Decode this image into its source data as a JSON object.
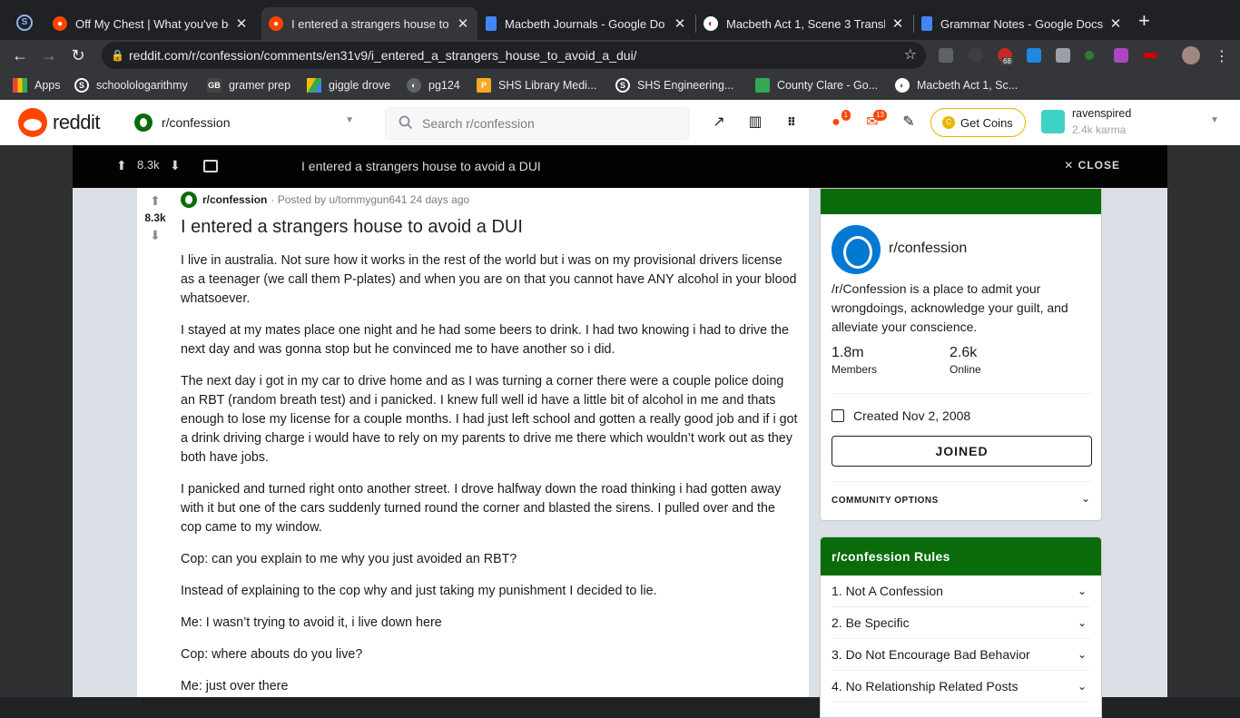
{
  "browser": {
    "tabs": [
      {
        "title": "Off My Chest | What you've be",
        "color": "#ff4500"
      },
      {
        "title": "I entered a strangers house to",
        "color": "#ff4500",
        "active": true
      },
      {
        "title": "Macbeth Journals - Google Do",
        "color": "#4285f4"
      },
      {
        "title": "Macbeth Act 1, Scene 3 Transl",
        "color": "#ffffff"
      },
      {
        "title": "Grammar Notes - Google Docs",
        "color": "#4285f4"
      }
    ],
    "url": "reddit.com/r/confession/comments/en31v9/i_entered_a_strangers_house_to_avoid_a_dui/",
    "ext_badge": "68",
    "bookmarks": [
      {
        "label": "Apps"
      },
      {
        "label": "schoolologarithmy"
      },
      {
        "label": "gramer prep"
      },
      {
        "label": "giggle drove"
      },
      {
        "label": "pg124"
      },
      {
        "label": "SHS Library Medi..."
      },
      {
        "label": "SHS Engineering..."
      },
      {
        "label": "County Clare - Go..."
      },
      {
        "label": "Macbeth Act 1, Sc..."
      }
    ]
  },
  "header": {
    "logo_text": "reddit",
    "community": "r/confession",
    "search_placeholder": "Search r/confession",
    "chat_badge": "1",
    "mail_badge": "13",
    "coins_label": "Get Coins",
    "username": "ravenspired",
    "karma": "2.4k karma"
  },
  "postbar": {
    "score": "8.3k",
    "title": "I entered a strangers house to avoid a DUI",
    "close_label": "CLOSE"
  },
  "post": {
    "score": "8.3k",
    "subreddit": "r/confession",
    "byline": "· Posted by u/tommygun641 24 days ago",
    "title": "I entered a strangers house to avoid a DUI",
    "paragraphs": [
      "I live in australia. Not sure how it works in the rest of the world but i was on my provisional drivers license as a teenager (we call them P-plates) and when you are on that you cannot have ANY alcohol in your blood whatsoever.",
      "I stayed at my mates place one night and he had some beers to drink. I had two knowing i had to drive the next day and was gonna stop but he convinced me to have another so i did.",
      "The next day i got in my car to drive home and as I was turning a corner there were a couple police doing an RBT (random breath test) and i panicked. I knew full well id have a little bit of alcohol in me and thats enough to lose my license for a couple months. I had just left school and gotten a really good job and if i got a drink driving charge i would have to rely on my parents to drive me there which wouldn’t work out as they both have jobs.",
      "I panicked and turned right onto another street. I drove halfway down the road thinking i had gotten away with it but one of the cars suddenly turned round the corner and blasted the sirens. I pulled over and the cop came to my window.",
      "Cop: can you explain to me why you just avoided an RBT?",
      "Instead of explaining to the cop why and just taking my punishment I decided to lie.",
      "Me: I wasn’t trying to avoid it, i live down here",
      "Cop: where abouts do you live?",
      "Me: just over there"
    ]
  },
  "sidebar": {
    "name": "r/confession",
    "description": "/r/Confession is a place to admit your wrongdoings, acknowledge your guilt, and alleviate your conscience.",
    "members": "1.8m",
    "members_label": "Members",
    "online": "2.6k",
    "online_label": "Online",
    "created": "Created Nov 2, 2008",
    "joined_label": "JOINED",
    "community_options": "COMMUNITY OPTIONS",
    "rules_title": "r/confession Rules",
    "rules": [
      "1. Not A Confession",
      "2. Be Specific",
      "3. Do Not Encourage Bad Behavior",
      "4. No Relationship Related Posts"
    ]
  },
  "colors": {
    "accent": "#ff4500",
    "community_green": "#0a6b0a",
    "community_blue": "#0079d3"
  }
}
